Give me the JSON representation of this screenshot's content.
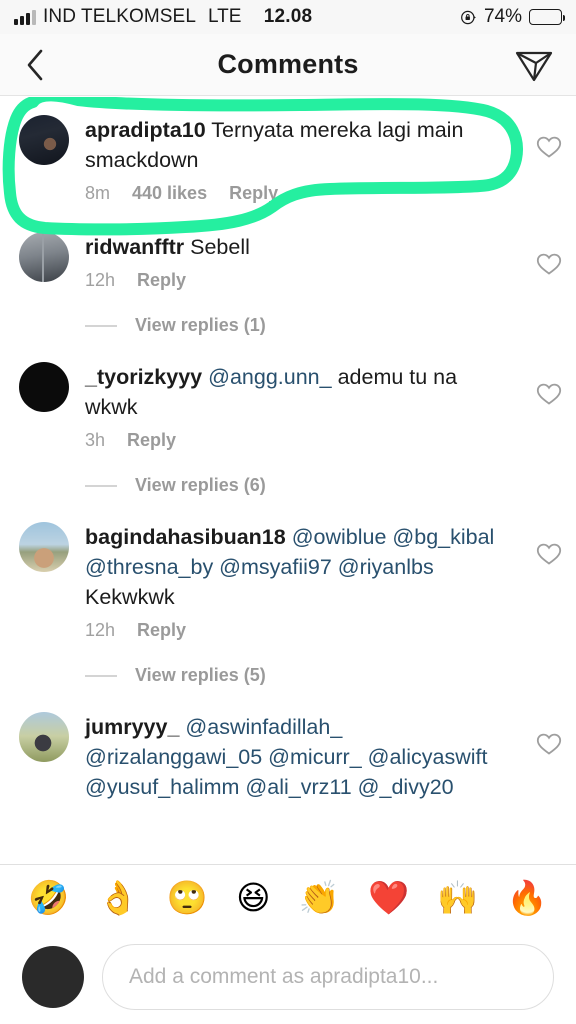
{
  "status_bar": {
    "carrier": "IND TELKOMSEL",
    "network": "LTE",
    "time": "12.08",
    "battery_percent": "74%",
    "battery_level": 74,
    "signal_bars": 3,
    "rotation_lock_icon": "rotation-lock-icon"
  },
  "header": {
    "title": "Comments",
    "back_icon": "back-chevron-icon",
    "share_icon": "direct-share-icon"
  },
  "annotation": {
    "color": "#25efa0",
    "shape": "hand-drawn-circle",
    "target": "first-comment"
  },
  "comments": [
    {
      "username": "apradipta10",
      "text": " Ternyata mereka lagi main smackdown",
      "mentions": [],
      "time": "8m",
      "likes": "440 likes",
      "reply": "Reply",
      "view_replies": null,
      "highlighted": true
    },
    {
      "username": "ridwanfftr",
      "text": " Sebell",
      "mentions": [],
      "time": "12h",
      "likes": null,
      "reply": "Reply",
      "view_replies": "View replies (1)",
      "highlighted": false
    },
    {
      "username": "_tyorizkyyy",
      "mention_line": "@angg.unn_",
      "text": " ademu tu na wkwk",
      "time": "3h",
      "likes": null,
      "reply": "Reply",
      "view_replies": "View replies (6)",
      "highlighted": false
    },
    {
      "username": "bagindahasibuan18",
      "mention_line": "@owiblue @bg_kibal @thresna_by @msyafii97 @riyanlbs",
      "text": " Kekwkwk",
      "time": "12h",
      "likes": null,
      "reply": "Reply",
      "view_replies": "View replies (5)",
      "highlighted": false
    },
    {
      "username": "jumryyy_",
      "mention_line": "@aswinfadillah_ @rizalanggawi_05 @micurr_ @alicyaswift @yusuf_halimm @ali_vrz11 @_divy20",
      "text": "",
      "time": null,
      "likes": null,
      "reply": null,
      "view_replies": null,
      "highlighted": false,
      "clipped": true
    }
  ],
  "emoji_bar": {
    "items": [
      {
        "glyph": "🤣",
        "name": "rolling-on-floor-laughing-emoji"
      },
      {
        "glyph": "👌",
        "name": "ok-hand-emoji"
      },
      {
        "glyph": "🙄",
        "name": "face-with-rolling-eyes-emoji"
      },
      {
        "glyph": "😆",
        "name": "grinning-squinting-face-emoji"
      },
      {
        "glyph": "👏",
        "name": "clapping-hands-emoji"
      },
      {
        "glyph": "❤️",
        "name": "red-heart-emoji"
      },
      {
        "glyph": "🙌",
        "name": "raising-hands-emoji"
      },
      {
        "glyph": "🔥",
        "name": "fire-emoji"
      }
    ]
  },
  "composer": {
    "placeholder": "Add a comment as apradipta10...",
    "avatar_name": "current-user-avatar"
  }
}
